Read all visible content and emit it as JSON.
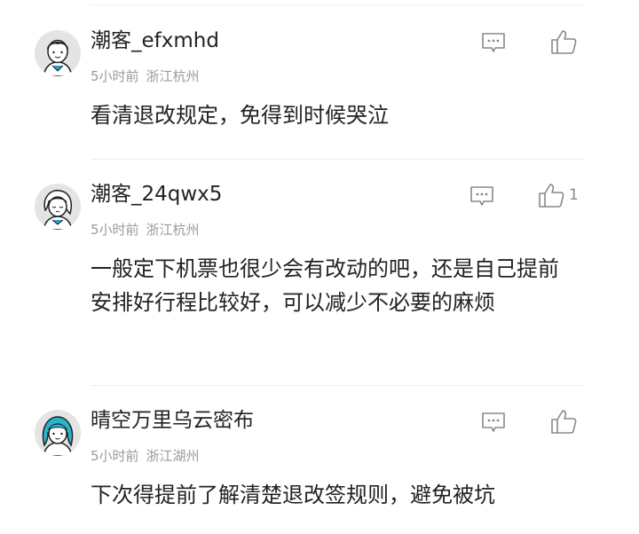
{
  "comments": [
    {
      "username": "潮客_efxmhd",
      "time": "5小时前",
      "location": "浙江杭州",
      "content": "看清退改规定，免得到时候哭泣",
      "likes": "",
      "avatar_icon": "male-user-avatar-icon"
    },
    {
      "username": "潮客_24qwx5",
      "time": "5小时前",
      "location": "浙江杭州",
      "content": "一般定下机票也很少会有改动的吧，还是自己提前安排好行程比较好，可以减少不必要的麻烦",
      "likes": "1",
      "avatar_icon": "female-user-avatar-icon"
    },
    {
      "username": "晴空万里乌云密布",
      "time": "5小时前",
      "location": "浙江湖州",
      "content": "下次得提前了解清楚退改签规则，避免被坑",
      "likes": "",
      "avatar_icon": "teal-haired-user-avatar-icon"
    }
  ],
  "icons": {
    "reply": "comment-reply-icon",
    "like": "thumbs-up-icon"
  },
  "colors": {
    "text": "#222222",
    "meta": "#9a9a9a",
    "icon": "#888888",
    "divider": "#eeeeee"
  }
}
